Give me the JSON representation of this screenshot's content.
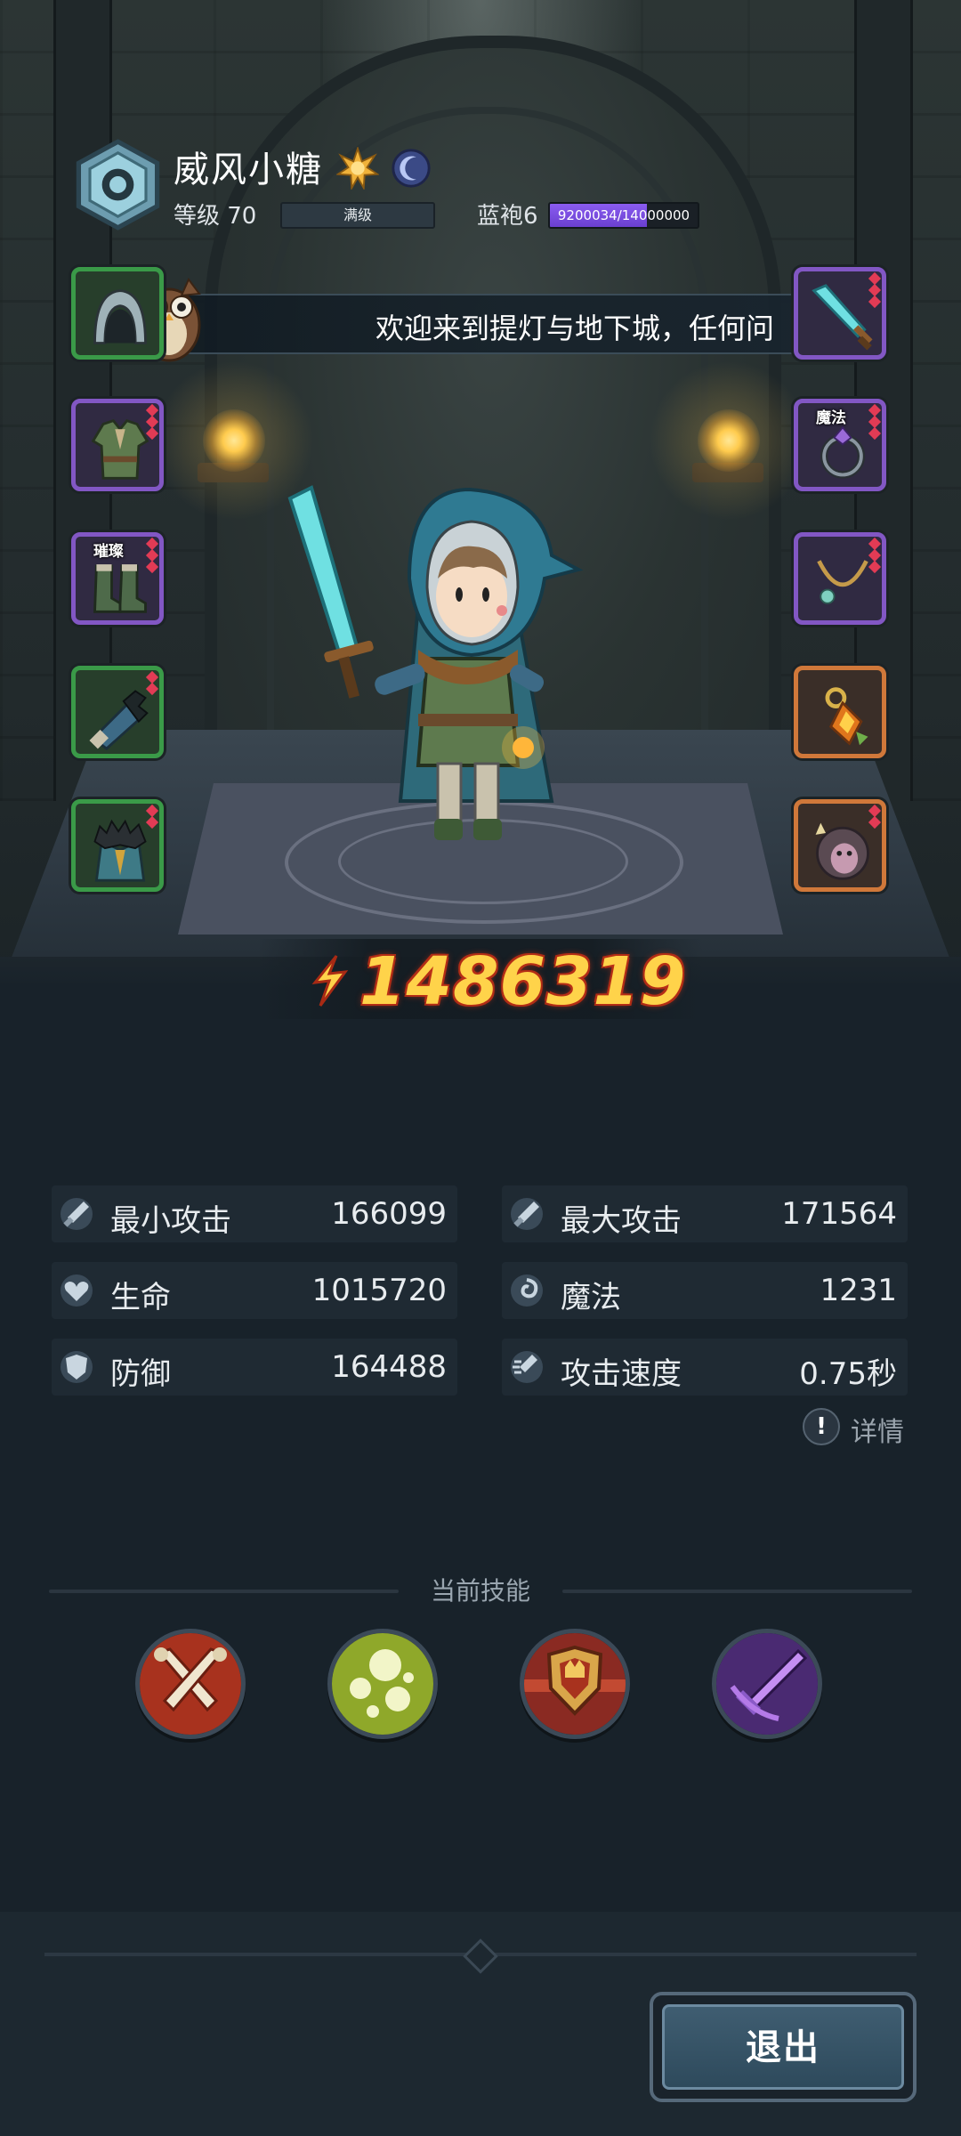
{
  "header": {
    "player_name": "威风小糖",
    "level_label": "等级 70",
    "level_status": "满级",
    "title_label": "蓝袍6",
    "xp_text": "9200034/14000000",
    "xp_fraction": 0.657,
    "badges": [
      "sun-badge-icon",
      "moon-badge-icon"
    ]
  },
  "chat": {
    "message": "欢迎来到提灯与地下城，任何问"
  },
  "equipment": {
    "left_slots": [
      {
        "name": "helmet-slot",
        "icon": "hood-helmet-icon",
        "rarity": "green"
      },
      {
        "name": "armor-slot",
        "icon": "tunic-armor-icon",
        "rarity": "purple"
      },
      {
        "name": "boots-slot",
        "icon": "boots-icon",
        "rarity": "purple",
        "tag": "璀璨"
      },
      {
        "name": "gloves-slot",
        "icon": "gauntlet-icon",
        "rarity": "green"
      },
      {
        "name": "cloak-slot",
        "icon": "fur-cloak-icon",
        "rarity": "green"
      }
    ],
    "right_slots": [
      {
        "name": "weapon-slot",
        "icon": "crystal-sword-icon",
        "rarity": "purple"
      },
      {
        "name": "ring-slot",
        "icon": "ring-icon",
        "rarity": "purple",
        "tag": "魔法"
      },
      {
        "name": "necklace-slot",
        "icon": "necklace-icon",
        "rarity": "purple"
      },
      {
        "name": "trinket-slot",
        "icon": "lantern-charm-icon",
        "rarity": "orange"
      },
      {
        "name": "pet-slot",
        "icon": "pet-icon",
        "rarity": "orange"
      }
    ]
  },
  "power": {
    "value": "1486319"
  },
  "stats": [
    {
      "label": "最小攻击",
      "value": "166099",
      "icon": "sword-icon"
    },
    {
      "label": "最大攻击",
      "value": "171564",
      "icon": "sword-icon"
    },
    {
      "label": "生命",
      "value": "1015720",
      "icon": "heart-icon"
    },
    {
      "label": "魔法",
      "value": "1231",
      "icon": "magic-swirl-icon"
    },
    {
      "label": "防御",
      "value": "164488",
      "icon": "shield-icon"
    },
    {
      "label": "攻击速度",
      "value": "0.75秒",
      "icon": "speed-icon"
    }
  ],
  "details": {
    "label": "详情"
  },
  "skills": {
    "title": "当前技能",
    "items": [
      {
        "icon": "crossed-swords-skill-icon"
      },
      {
        "icon": "spore-bubbles-skill-icon"
      },
      {
        "icon": "shield-crest-skill-icon"
      },
      {
        "icon": "purple-dagger-skill-icon"
      }
    ]
  },
  "footer": {
    "exit_label": "退出"
  },
  "colors": {
    "background": "#18222a",
    "power_text": "#ffd34a",
    "xp_fill": "#7a4ee0",
    "rarity_green": "#3a9a48",
    "rarity_purple": "#8257c4",
    "rarity_orange": "#d0783a"
  }
}
